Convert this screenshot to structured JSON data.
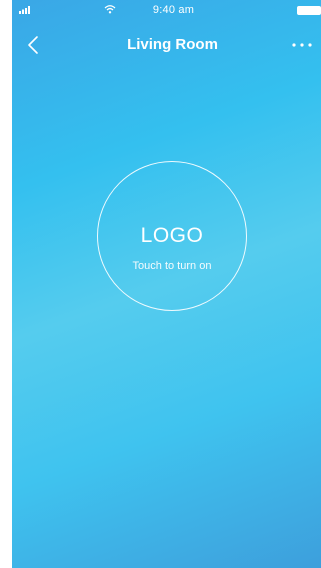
{
  "status_bar": {
    "time": "9:40 am"
  },
  "nav": {
    "title": "Living Room",
    "back_icon": "chevron-left-icon",
    "more_icon": "more-horizontal-icon"
  },
  "device": {
    "logo_text": "LOGO",
    "hint": "Touch to turn on"
  },
  "colors": {
    "gradient_start": "#3aa7e6",
    "gradient_mid": "#55ccee",
    "gradient_end": "#3d9fdc",
    "foreground": "#ffffff"
  }
}
